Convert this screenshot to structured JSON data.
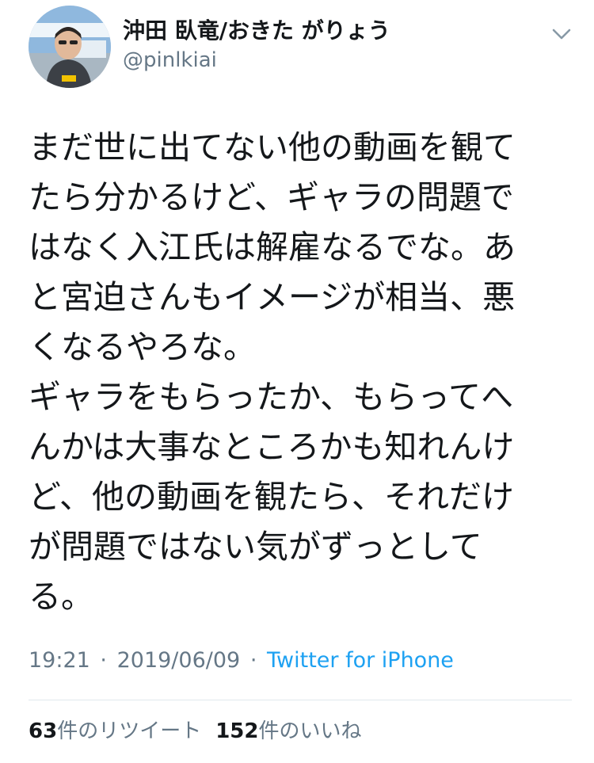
{
  "author": {
    "display_name": "沖田 臥竜/おきた がりょう",
    "handle": "@pinlkiai"
  },
  "tweet": {
    "lines": [
      "まだ世に出てない他の動画を観て",
      "たら分かるけど、ギャラの問題で",
      "はなく入江氏は解雇なるでな。あ",
      "と宮迫さんもイメージが相当、悪",
      "くなるやろな。",
      "ギャラをもらったか、もらってへ",
      "んかは大事なところかも知れんけ",
      "ど、他の動画を観たら、それだけ",
      "が問題ではない気がずっとして",
      "る。"
    ],
    "time": "19:21",
    "separator": "·",
    "date": "2019/06/09",
    "source": "Twitter for iPhone"
  },
  "stats": {
    "retweets_count": "63",
    "retweets_label": "件のリツイート",
    "likes_count": "152",
    "likes_label": "件のいいね"
  },
  "icons": {
    "avatar": "profile-photo",
    "more": "chevron-down-icon"
  },
  "colors": {
    "text": "#14171a",
    "secondary": "#657786",
    "link": "#1da1f2",
    "divider": "#e1e8ed"
  }
}
